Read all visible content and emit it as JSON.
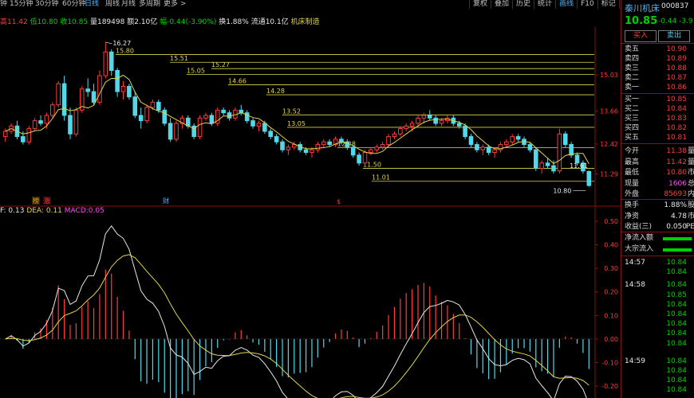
{
  "tabs": [
    "钟",
    "15分钟",
    "30分钟",
    "60分钟",
    "日线",
    "周线",
    "月线",
    "多周期",
    "更多 >"
  ],
  "active_tab": "日线",
  "top_buttons": [
    "复权",
    "叠加",
    "历史",
    "统计",
    "画线",
    "F10",
    "标记",
    "返回"
  ],
  "highlight_button": "画线",
  "info": {
    "high_label": "高",
    "high": "11.42",
    "low_label": "低",
    "low": "10.80",
    "close_label": "收",
    "close": "10.85",
    "volume_label": "量",
    "volume": "189498",
    "amount_label": "额",
    "amount": "2.10亿",
    "range_label": "幅",
    "range": "-0.44(-3.90%)",
    "turnover_label": "换",
    "turnover": "1.88%",
    "float_label": "流通",
    "float": "10.1亿",
    "sector": "机床制造"
  },
  "macd": {
    "dif_label": "F:",
    "dif": "0.13",
    "dea_label": "DEA:",
    "dea": "0.11",
    "macd_label": "MACD:",
    "macd": "0.05"
  },
  "price_axis": [
    "15.03",
    "13.66",
    "12.42",
    "11.29"
  ],
  "macd_axis": [
    "0.50",
    "0.40",
    "0.30",
    "0.20",
    "0.10",
    "0.00",
    "-0.10",
    "-0.20"
  ],
  "levels": [
    "15.80",
    "15.51",
    "15.27",
    "15.05",
    "14.66",
    "14.28",
    "13.52",
    "13.05",
    "12.28",
    "11.50",
    "11.01"
  ],
  "max_label": "16.27",
  "min_label": "10.80",
  "current_marker": "11.61",
  "event_markers": [
    "榜",
    "涨",
    "财",
    "$"
  ],
  "panel": {
    "name": "秦川机床",
    "code": "000837",
    "code_suffix": "R",
    "price": "10.85",
    "change": "-0.44",
    "change_pct": "-3.9",
    "buy_label": "买入",
    "sell_label": "卖出",
    "asks": [
      {
        "label": "卖五",
        "price": "10.90"
      },
      {
        "label": "卖四",
        "price": "10.89"
      },
      {
        "label": "卖三",
        "price": "10.88"
      },
      {
        "label": "卖二",
        "price": "10.87"
      },
      {
        "label": "卖一",
        "price": "10.86"
      }
    ],
    "bids": [
      {
        "label": "买一",
        "price": "10.85"
      },
      {
        "label": "买二",
        "price": "10.84"
      },
      {
        "label": "买三",
        "price": "10.83"
      },
      {
        "label": "买四",
        "price": "10.82"
      },
      {
        "label": "买五",
        "price": "10.81"
      }
    ],
    "stats": [
      {
        "label": "今开",
        "value": "11.38",
        "extra": "量"
      },
      {
        "label": "最高",
        "value": "11.42",
        "extra": "量"
      },
      {
        "label": "最低",
        "value": "10.80",
        "extra": "市"
      },
      {
        "label": "现量",
        "value": "1606",
        "extra": "总"
      },
      {
        "label": "外盘",
        "value": "85693",
        "extra": "内"
      }
    ],
    "stats2": [
      {
        "label": "换手",
        "value": "1.88%",
        "extra": "股"
      },
      {
        "label": "净资",
        "value": "4.78",
        "extra": "市"
      },
      {
        "label": "收益(三)",
        "value": "0.050",
        "extra": "PE"
      }
    ],
    "flows": [
      "净流入额",
      "大宗流入"
    ],
    "ticks": [
      {
        "time": "14:57",
        "price": "10.84"
      },
      {
        "time": "",
        "price": "10.84"
      },
      {
        "time": "14:58",
        "price": "10.84"
      },
      {
        "time": "",
        "price": "10.85"
      },
      {
        "time": "",
        "price": "10.84"
      },
      {
        "time": "",
        "price": "10.84"
      },
      {
        "time": "",
        "price": "10.84"
      },
      {
        "time": "",
        "price": "10.84"
      },
      {
        "time": "",
        "price": "10.84"
      },
      {
        "time": "14:59",
        "price": "10.84"
      },
      {
        "time": "",
        "price": "10.84"
      },
      {
        "time": "",
        "price": "10.84"
      },
      {
        "time": "",
        "price": "10.84"
      }
    ]
  },
  "colors": {
    "up": "#ff3b3b",
    "down": "#54d8e8",
    "ma": "#e0d44a",
    "dif": "#e8e8e8",
    "dea": "#e0d44a",
    "grid": "#8a1010",
    "accent": "#4fb4ff"
  },
  "chart_data": {
    "type": "candlestick",
    "price_ylim": [
      10.4,
      16.6
    ],
    "candles": [
      [
        12.7,
        13.0,
        12.5,
        12.9
      ],
      [
        12.9,
        13.2,
        12.8,
        13.1
      ],
      [
        13.1,
        13.3,
        12.6,
        12.7
      ],
      [
        12.7,
        12.9,
        12.4,
        12.5
      ],
      [
        12.5,
        13.1,
        12.4,
        13.0
      ],
      [
        13.0,
        13.4,
        12.9,
        13.3
      ],
      [
        13.3,
        13.5,
        13.1,
        13.2
      ],
      [
        13.2,
        13.6,
        13.0,
        13.5
      ],
      [
        13.5,
        14.0,
        13.4,
        13.9
      ],
      [
        13.9,
        14.8,
        13.8,
        14.7
      ],
      [
        14.7,
        15.0,
        13.3,
        13.5
      ],
      [
        13.5,
        13.8,
        12.6,
        12.8
      ],
      [
        12.8,
        13.8,
        12.7,
        13.7
      ],
      [
        13.7,
        14.6,
        13.6,
        14.5
      ],
      [
        14.5,
        14.9,
        14.2,
        14.4
      ],
      [
        14.4,
        14.7,
        13.9,
        14.0
      ],
      [
        14.0,
        15.2,
        13.9,
        15.0
      ],
      [
        15.0,
        16.27,
        14.9,
        15.9
      ],
      [
        15.9,
        16.0,
        15.0,
        15.2
      ],
      [
        15.2,
        15.3,
        14.2,
        14.4
      ],
      [
        14.4,
        14.8,
        14.1,
        14.6
      ],
      [
        14.6,
        14.7,
        14.1,
        14.2
      ],
      [
        14.2,
        14.4,
        13.4,
        13.5
      ],
      [
        13.5,
        13.8,
        13.0,
        13.3
      ],
      [
        13.3,
        13.9,
        13.2,
        13.8
      ],
      [
        13.8,
        14.1,
        13.7,
        14.0
      ],
      [
        14.0,
        14.1,
        13.6,
        13.7
      ],
      [
        13.7,
        13.8,
        13.1,
        13.2
      ],
      [
        13.2,
        13.4,
        12.5,
        12.6
      ],
      [
        12.6,
        13.3,
        12.5,
        13.2
      ],
      [
        13.2,
        13.5,
        13.0,
        13.4
      ],
      [
        13.4,
        13.5,
        13.0,
        13.1
      ],
      [
        13.1,
        13.2,
        12.6,
        12.7
      ],
      [
        12.7,
        13.5,
        12.6,
        13.4
      ],
      [
        13.4,
        13.6,
        13.3,
        13.5
      ],
      [
        13.5,
        13.6,
        13.1,
        13.2
      ],
      [
        13.2,
        13.8,
        13.1,
        13.7
      ],
      [
        13.7,
        13.8,
        13.5,
        13.6
      ],
      [
        13.6,
        13.7,
        13.3,
        13.4
      ],
      [
        13.4,
        13.8,
        13.3,
        13.7
      ],
      [
        13.7,
        13.9,
        13.5,
        13.6
      ],
      [
        13.6,
        13.7,
        13.2,
        13.3
      ],
      [
        13.3,
        13.4,
        13.0,
        13.1
      ],
      [
        13.1,
        13.3,
        12.9,
        13.2
      ],
      [
        13.2,
        13.3,
        12.8,
        12.9
      ],
      [
        12.9,
        13.0,
        12.6,
        12.7
      ],
      [
        12.7,
        12.8,
        12.4,
        12.5
      ],
      [
        12.5,
        12.6,
        12.1,
        12.2
      ],
      [
        12.2,
        12.4,
        12.0,
        12.3
      ],
      [
        12.3,
        12.5,
        12.2,
        12.4
      ],
      [
        12.4,
        12.5,
        12.1,
        12.2
      ],
      [
        12.2,
        12.3,
        12.0,
        12.1
      ],
      [
        12.1,
        12.3,
        11.9,
        12.2
      ],
      [
        12.2,
        12.5,
        12.1,
        12.4
      ],
      [
        12.4,
        12.6,
        12.3,
        12.5
      ],
      [
        12.5,
        12.6,
        12.3,
        12.4
      ],
      [
        12.4,
        12.7,
        12.3,
        12.6
      ],
      [
        12.6,
        12.7,
        12.4,
        12.5
      ],
      [
        12.5,
        12.6,
        12.2,
        12.3
      ],
      [
        12.3,
        12.4,
        11.9,
        12.0
      ],
      [
        12.0,
        12.1,
        11.6,
        11.7
      ],
      [
        11.7,
        12.2,
        11.6,
        12.1
      ],
      [
        12.1,
        12.3,
        12.0,
        12.2
      ],
      [
        12.2,
        12.4,
        12.1,
        12.3
      ],
      [
        12.3,
        12.5,
        12.2,
        12.4
      ],
      [
        12.4,
        12.8,
        12.3,
        12.7
      ],
      [
        12.7,
        12.9,
        12.6,
        12.8
      ],
      [
        12.8,
        13.1,
        12.7,
        13.0
      ],
      [
        13.0,
        13.2,
        12.9,
        13.1
      ],
      [
        13.1,
        13.3,
        12.9,
        13.2
      ],
      [
        13.2,
        13.5,
        13.1,
        13.4
      ],
      [
        13.4,
        13.6,
        13.2,
        13.5
      ],
      [
        13.5,
        13.7,
        13.3,
        13.4
      ],
      [
        13.4,
        13.5,
        13.1,
        13.2
      ],
      [
        13.2,
        13.4,
        13.1,
        13.3
      ],
      [
        13.3,
        13.5,
        13.2,
        13.4
      ],
      [
        13.4,
        13.5,
        13.1,
        13.2
      ],
      [
        13.2,
        13.3,
        13.0,
        13.1
      ],
      [
        13.1,
        13.2,
        12.6,
        12.7
      ],
      [
        12.7,
        12.8,
        12.3,
        12.4
      ],
      [
        12.4,
        12.5,
        12.1,
        12.2
      ],
      [
        12.2,
        12.4,
        12.0,
        12.3
      ],
      [
        12.3,
        12.4,
        12.0,
        12.1
      ],
      [
        12.1,
        12.3,
        11.9,
        12.2
      ],
      [
        12.2,
        12.5,
        12.1,
        12.4
      ],
      [
        12.4,
        12.6,
        12.3,
        12.5
      ],
      [
        12.5,
        12.8,
        12.4,
        12.7
      ],
      [
        12.7,
        12.8,
        12.5,
        12.6
      ],
      [
        12.6,
        12.7,
        12.3,
        12.4
      ],
      [
        12.4,
        12.5,
        12.1,
        12.2
      ],
      [
        12.2,
        12.3,
        11.4,
        11.5
      ],
      [
        11.5,
        11.8,
        11.3,
        11.7
      ],
      [
        11.7,
        11.9,
        11.5,
        11.6
      ],
      [
        11.6,
        11.8,
        11.3,
        11.4
      ],
      [
        11.4,
        13.0,
        11.3,
        12.8
      ],
      [
        12.8,
        12.9,
        12.3,
        12.4
      ],
      [
        12.4,
        12.5,
        11.9,
        12.0
      ],
      [
        12.0,
        12.1,
        11.6,
        11.7
      ],
      [
        11.7,
        11.8,
        11.3,
        11.4
      ],
      [
        11.38,
        11.42,
        10.8,
        10.85
      ]
    ]
  }
}
